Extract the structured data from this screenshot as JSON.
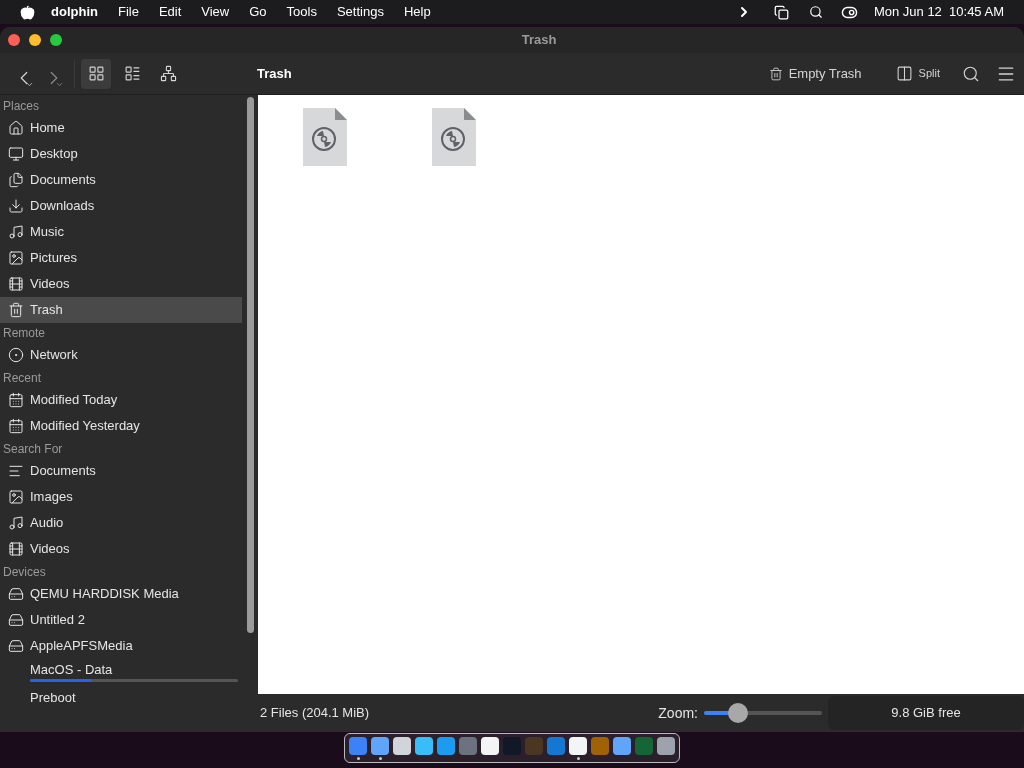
{
  "menubar": {
    "app": "dolphin",
    "menus": [
      "File",
      "Edit",
      "View",
      "Go",
      "Tools",
      "Settings",
      "Help"
    ],
    "clock": "Mon Jun 12  10:45 AM"
  },
  "window": {
    "title": "Trash"
  },
  "toolbar": {
    "views": [
      {
        "kind": "icons",
        "selected": true
      },
      {
        "kind": "details",
        "selected": false
      },
      {
        "kind": "tree",
        "selected": false
      }
    ],
    "location": "Trash",
    "empty_trash": "Empty Trash",
    "split": "Split"
  },
  "sidebar": {
    "sections": [
      {
        "title": "Places",
        "items": [
          {
            "kind": "home",
            "label": "Home",
            "selected": false
          },
          {
            "kind": "desktop",
            "label": "Desktop",
            "selected": false
          },
          {
            "kind": "documents",
            "label": "Documents",
            "selected": false
          },
          {
            "kind": "downloads",
            "label": "Downloads",
            "selected": false
          },
          {
            "kind": "music",
            "label": "Music",
            "selected": false
          },
          {
            "kind": "pictures",
            "label": "Pictures",
            "selected": false
          },
          {
            "kind": "videos",
            "label": "Videos",
            "selected": false
          },
          {
            "kind": "trash",
            "label": "Trash",
            "selected": true
          }
        ]
      },
      {
        "title": "Remote",
        "items": [
          {
            "kind": "network",
            "label": "Network",
            "selected": false
          }
        ]
      },
      {
        "title": "Recent",
        "items": [
          {
            "kind": "calendar",
            "label": "Modified Today",
            "selected": false
          },
          {
            "kind": "calendar",
            "label": "Modified Yesterday",
            "selected": false
          }
        ]
      },
      {
        "title": "Search For",
        "items": [
          {
            "kind": "text",
            "label": "Documents",
            "selected": false
          },
          {
            "kind": "pictures",
            "label": "Images",
            "selected": false
          },
          {
            "kind": "music",
            "label": "Audio",
            "selected": false
          },
          {
            "kind": "videos",
            "label": "Videos",
            "selected": false
          }
        ]
      },
      {
        "title": "Devices",
        "items": [
          {
            "kind": "drive",
            "label": "QEMU HARDDISK Media",
            "selected": false
          },
          {
            "kind": "drive",
            "label": "Untitled 2",
            "selected": false
          },
          {
            "kind": "drive",
            "label": "AppleAPFSMedia",
            "selected": false
          },
          {
            "kind": "volume",
            "label": "MacOS - Data",
            "level": 0.3,
            "selected": false
          },
          {
            "kind": "volume-plain",
            "label": "Preboot",
            "selected": false
          }
        ]
      }
    ]
  },
  "files": [
    {
      "kind": "disc"
    },
    {
      "kind": "disc"
    }
  ],
  "status_bar": {
    "summary": "2 Files (204.1 MiB)",
    "zoom_label": "Zoom:",
    "zoom": {
      "level": 0.29
    },
    "free_space": "9.8 GiB free"
  },
  "dock": [
    {
      "kind": "finder",
      "running": true
    },
    {
      "kind": "folder",
      "running": true
    },
    {
      "kind": "launchpad",
      "running": false
    },
    {
      "kind": "safari",
      "running": false
    },
    {
      "kind": "appstore",
      "running": false
    },
    {
      "kind": "settings",
      "running": false
    },
    {
      "kind": "textedit",
      "running": false
    },
    {
      "kind": "terminal",
      "running": false
    },
    {
      "kind": "brush",
      "running": false
    },
    {
      "kind": "vscode",
      "running": false
    },
    {
      "kind": "chrome",
      "running": true
    },
    {
      "kind": "paint",
      "running": false
    },
    {
      "kind": "folder",
      "running": false
    },
    {
      "kind": "image",
      "running": false
    },
    {
      "kind": "trash",
      "running": false
    }
  ]
}
